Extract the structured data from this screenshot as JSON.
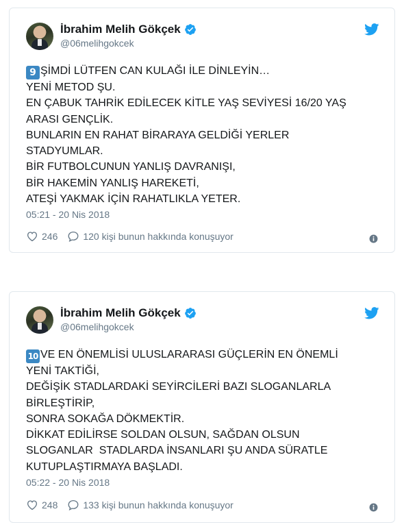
{
  "colors": {
    "accent": "#1da1f2",
    "text": "#14171a",
    "muted": "#657786",
    "border": "#e1e8ed",
    "keycap": "#3b88c3"
  },
  "tweets": [
    {
      "author": "İbrahim Melih Gökçek",
      "handle": "@06melihgokcek",
      "keycap": "9",
      "lines": [
        "ŞİMDİ LÜTFEN CAN KULAĞI İLE DİNLEYİN…",
        "YENİ METOD ŞU.",
        "EN ÇABUK TAHRİK EDİLECEK KİTLE YAŞ SEVİYESİ 16/20 YAŞ",
        "ARASI GENÇLİK.",
        "BUNLARIN EN RAHAT BİRARAYA GELDİĞİ YERLER",
        "STADYUMLAR.",
        "BİR FUTBOLCUNUN YANLIŞ DAVRANIŞI,",
        "BİR HAKEMİN YANLIŞ HAREKETİ,",
        "ATEŞİ YAKMAK İÇİN RAHATLIKLA YETER."
      ],
      "timestamp": "05:21 - 20 Nis 2018",
      "likes": "246",
      "replies": "120 kişi bunun hakkında konuşuyor"
    },
    {
      "author": "İbrahim Melih Gökçek",
      "handle": "@06melihgokcek",
      "keycap": "10",
      "lines": [
        "VE EN ÖNEMLİSİ ULUSLARARASI GÜÇLERİN EN ÖNEMLİ",
        "YENİ TAKTİĞİ,",
        "DEĞİŞİK STADLARDAKİ SEYİRCİLERİ BAZI SLOGANLARLA",
        "BİRLEŞTİRİP,",
        "SONRA SOKAĞA DÖKMEKTİR.",
        "DİKKAT EDİLİRSE SOLDAN OLSUN, SAĞDAN OLSUN",
        "SLOGANLAR  STADLARDA İNSANLARI ŞU ANDA SÜRATLE",
        "KUTUPLAŞTIRMAYA BAŞLADI."
      ],
      "timestamp": "05:22 - 20 Nis 2018",
      "likes": "248",
      "replies": "133 kişi bunun hakkında konuşuyor"
    }
  ]
}
